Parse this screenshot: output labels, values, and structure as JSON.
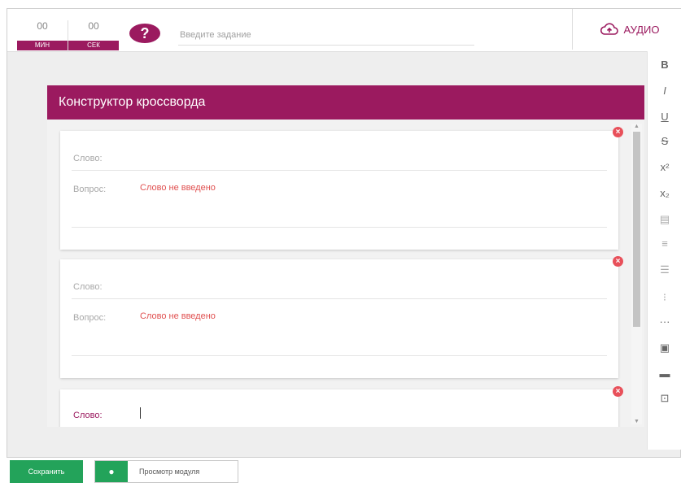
{
  "timer": {
    "minutes": "00",
    "minutes_label": "МИН",
    "seconds": "00",
    "seconds_label": "СЕК"
  },
  "help_icon_glyph": "?",
  "task_input": {
    "placeholder": "Введите задание",
    "value": ""
  },
  "audio_button": {
    "label": "АУДИО",
    "icon": "cloud-upload-icon"
  },
  "format_toolbar": [
    {
      "name": "bold-button",
      "glyph": "B"
    },
    {
      "name": "italic-button",
      "glyph": "I"
    },
    {
      "name": "underline-button",
      "glyph": "U"
    },
    {
      "name": "strikethrough-button",
      "glyph": "S"
    },
    {
      "name": "superscript-button",
      "glyph": "x²"
    },
    {
      "name": "subscript-button",
      "glyph": "x₂"
    },
    {
      "name": "copy-format-button",
      "glyph": "▤"
    },
    {
      "name": "align-button",
      "glyph": "≡"
    },
    {
      "name": "list-button",
      "glyph": "☰"
    },
    {
      "name": "ordered-list-button",
      "glyph": "⁝"
    },
    {
      "name": "more-button",
      "glyph": "···"
    },
    {
      "name": "comment-button",
      "glyph": "▣"
    },
    {
      "name": "media-button",
      "glyph": "▬"
    },
    {
      "name": "crop-button",
      "glyph": "⊡"
    }
  ],
  "panel": {
    "title": "Конструктор кроссворда",
    "word_label": "Слово:",
    "question_label": "Вопрос:",
    "empty_word_message": "Слово не введено",
    "cards": [
      {
        "word": "",
        "question_status": "Слово не введено"
      },
      {
        "word": "",
        "question_status": "Слово не введено"
      },
      {
        "word": ""
      }
    ]
  },
  "bottom": {
    "save_label": "Сохранить",
    "preview_label": "Просмотр модуля"
  },
  "colors": {
    "accent": "#9b1a5f",
    "success": "#23a35a",
    "error": "#e05050"
  }
}
